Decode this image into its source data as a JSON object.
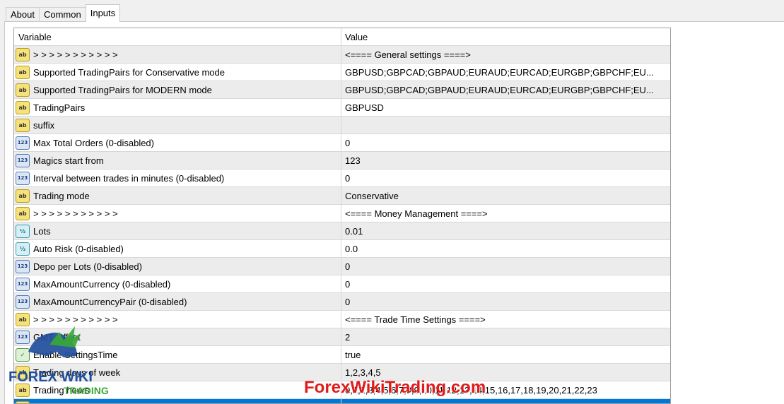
{
  "tabs": [
    {
      "label": "About",
      "active": false
    },
    {
      "label": "Common",
      "active": false
    },
    {
      "label": "Inputs",
      "active": true
    }
  ],
  "grid": {
    "columns": {
      "variable": "Variable",
      "value": "Value"
    },
    "rows": [
      {
        "icon": "text-icon",
        "variable": "> > > > > > > > > > >",
        "value": "<==== General settings ====>"
      },
      {
        "icon": "text-icon",
        "variable": "Supported TradingPairs for Conservative mode",
        "value": "GBPUSD;GBPCAD;GBPAUD;EURAUD;EURCAD;EURGBP;GBPCHF;EU..."
      },
      {
        "icon": "text-icon",
        "variable": "Supported TradingPairs for MODERN mode",
        "value": "GBPUSD;GBPCAD;GBPAUD;EURAUD;EURCAD;EURGBP;GBPCHF;EU..."
      },
      {
        "icon": "text-icon",
        "variable": "TradingPairs",
        "value": "GBPUSD"
      },
      {
        "icon": "text-icon",
        "variable": "suffix",
        "value": ""
      },
      {
        "icon": "integer-icon",
        "variable": "Max Total Orders (0-disabled)",
        "value": "0"
      },
      {
        "icon": "integer-icon",
        "variable": "Magics start from",
        "value": "123"
      },
      {
        "icon": "integer-icon",
        "variable": "Interval between trades in minutes (0-disabled)",
        "value": "0"
      },
      {
        "icon": "text-icon",
        "variable": "Trading mode",
        "value": "Conservative"
      },
      {
        "icon": "text-icon",
        "variable": "> > > > > > > > > > >",
        "value": "<==== Money Management ====>"
      },
      {
        "icon": "double-icon",
        "variable": "Lots",
        "value": "0.01"
      },
      {
        "icon": "double-icon",
        "variable": "Auto Risk (0-disabled)",
        "value": "0.0"
      },
      {
        "icon": "integer-icon",
        "variable": "Depo per Lots (0-disabled)",
        "value": "0"
      },
      {
        "icon": "integer-icon",
        "variable": "MaxAmountCurrency (0-disabled)",
        "value": "0"
      },
      {
        "icon": "integer-icon",
        "variable": "MaxAmountCurrencyPair (0-disabled)",
        "value": "0"
      },
      {
        "icon": "text-icon",
        "variable": "> > > > > > > > > > >",
        "value": "<==== Trade Time Settings ====>"
      },
      {
        "icon": "integer-icon",
        "variable": "GMT Offset",
        "value": "2"
      },
      {
        "icon": "boolean-icon",
        "variable": "Enable SettingsTime",
        "value": "true"
      },
      {
        "icon": "text-icon",
        "variable": "Trading days of week",
        "value": "1,2,3,4,5"
      },
      {
        "icon": "text-icon",
        "variable": "Trading hours",
        "value": "0,1,2,3,4,5,6,7,8,9,10,11,12,13,14,15,16,17,18,19,20,21,22,23"
      },
      {
        "icon": "text-icon",
        "variable": "",
        "value": ""
      }
    ]
  },
  "watermark": {
    "text": "ForexWikiTrading.com",
    "logo_text": "FOREX WIKI",
    "logo_sub": "TRADING"
  },
  "colors": {
    "selection": "#0078d7",
    "watermark": "#e11b1b",
    "alt_row": "#ececec"
  }
}
